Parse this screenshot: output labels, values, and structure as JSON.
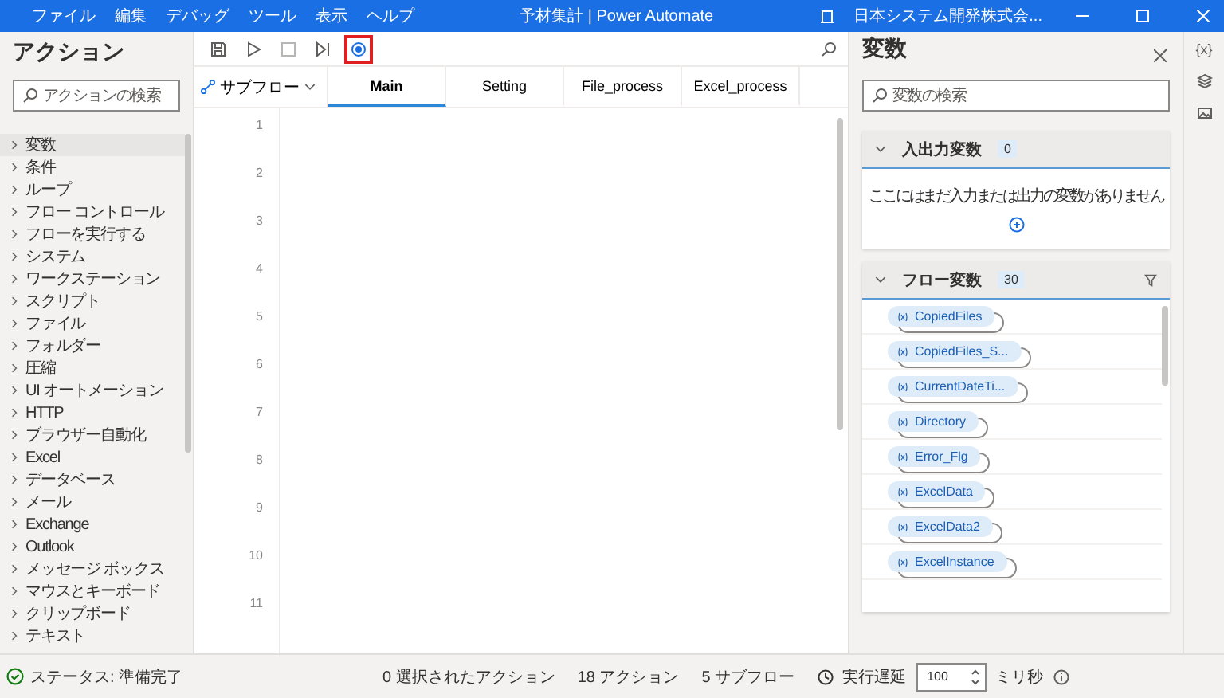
{
  "menu": [
    "ファイル",
    "編集",
    "デバッグ",
    "ツール",
    "表示",
    "ヘルプ"
  ],
  "window": {
    "title": "予材集計 | Power Automate",
    "account": "日本システム開発株式会..."
  },
  "actions_panel": {
    "title": "アクション",
    "search": {
      "placeholder": "アクションの検索"
    },
    "items": [
      {
        "label": "変数",
        "selected": true
      },
      {
        "label": "条件",
        "selected": false
      },
      {
        "label": "ループ",
        "selected": false
      },
      {
        "label": "フロー コントロール",
        "selected": false
      },
      {
        "label": "フローを実行する",
        "selected": false
      },
      {
        "label": "システム",
        "selected": false
      },
      {
        "label": "ワークステーション",
        "selected": false
      },
      {
        "label": "スクリプト",
        "selected": false
      },
      {
        "label": "ファイル",
        "selected": false
      },
      {
        "label": "フォルダー",
        "selected": false
      },
      {
        "label": "圧縮",
        "selected": false
      },
      {
        "label": "UI オートメーション",
        "selected": false
      },
      {
        "label": "HTTP",
        "selected": false
      },
      {
        "label": "ブラウザー自動化",
        "selected": false
      },
      {
        "label": "Excel",
        "selected": false
      },
      {
        "label": "データベース",
        "selected": false
      },
      {
        "label": "メール",
        "selected": false
      },
      {
        "label": "Exchange",
        "selected": false
      },
      {
        "label": "Outlook",
        "selected": false
      },
      {
        "label": "メッセージ ボックス",
        "selected": false
      },
      {
        "label": "マウスとキーボード",
        "selected": false
      },
      {
        "label": "クリップボード",
        "selected": false
      },
      {
        "label": "テキスト",
        "selected": false
      }
    ]
  },
  "toolbar": [
    {
      "kind": "save",
      "highlighted": false,
      "disabled": false
    },
    {
      "kind": "run",
      "highlighted": false,
      "disabled": false
    },
    {
      "kind": "stop",
      "highlighted": false,
      "disabled": true
    },
    {
      "kind": "step",
      "highlighted": false,
      "disabled": false
    },
    {
      "kind": "record",
      "highlighted": true,
      "disabled": false
    }
  ],
  "subflow_button": "サブフロー",
  "tabs": [
    {
      "label": "Main",
      "selected": true
    },
    {
      "label": "Setting",
      "selected": false
    },
    {
      "label": "File_process",
      "selected": false
    },
    {
      "label": "Excel_process",
      "selected": false
    }
  ],
  "line_numbers": [
    "1",
    "2",
    "3",
    "4",
    "5",
    "6",
    "7",
    "8",
    "9",
    "10",
    "11"
  ],
  "variables_panel": {
    "title": "変数",
    "search": {
      "placeholder": "変数の検索"
    },
    "sections": [
      {
        "title": "入出力変数",
        "count": "0",
        "expanded": true,
        "empty_text": "ここにはまだ入力または出力の変数がありません"
      },
      {
        "title": "フロー変数",
        "count": "30",
        "expanded": true,
        "variables": [
          "CopiedFiles",
          "CopiedFiles_S...",
          "CurrentDateTi...",
          "Directory",
          "Error_Flg",
          "ExcelData",
          "ExcelData2",
          "ExcelInstance"
        ]
      }
    ]
  },
  "rail": {
    "variables_label": "{x}"
  },
  "status_bar": {
    "status": "ステータス: 準備完了",
    "selected_actions": "0 選択されたアクション",
    "actions": "18 アクション",
    "subflows": "5 サブフロー",
    "delay_label": "実行遅延",
    "delay_value": "100",
    "unit": "ミリ秒"
  }
}
